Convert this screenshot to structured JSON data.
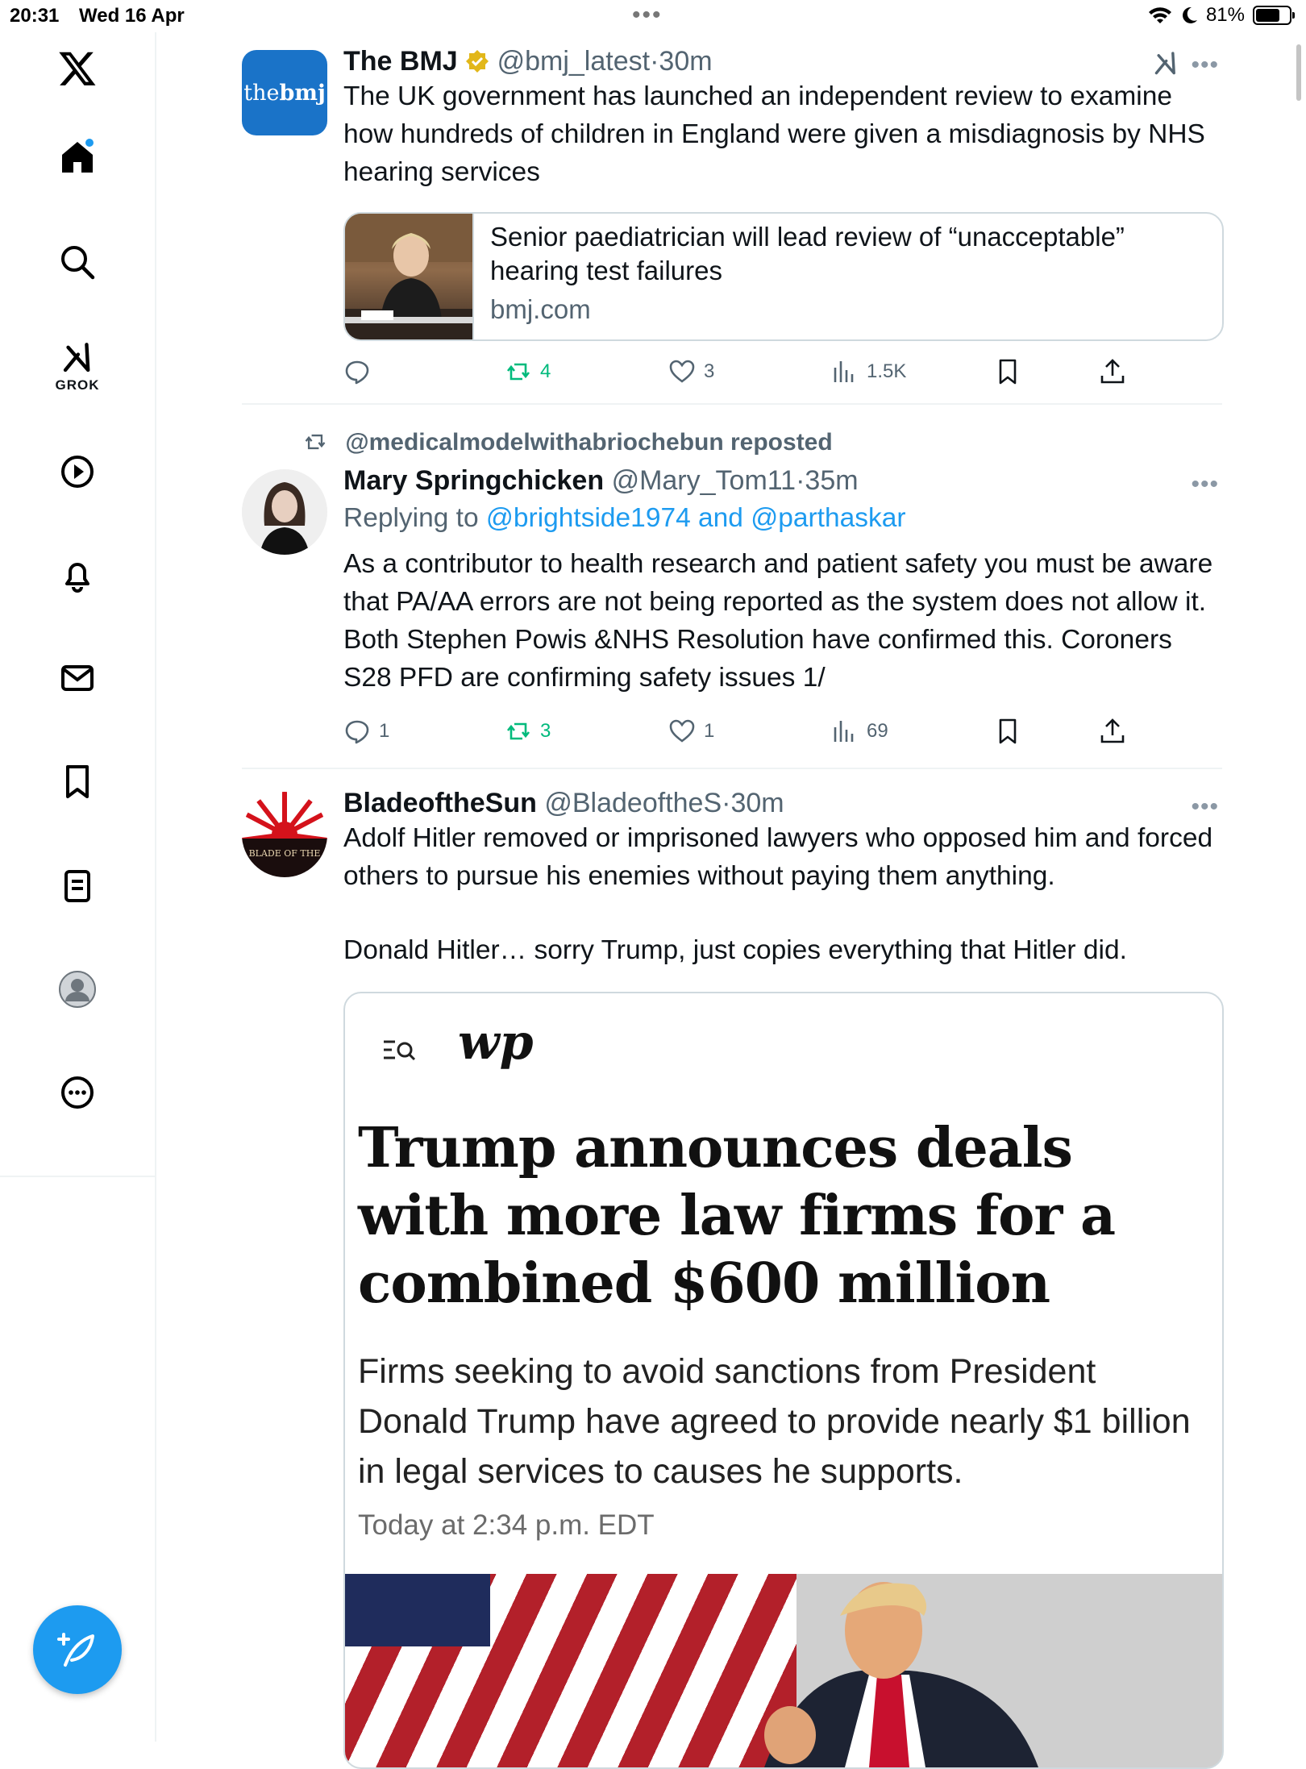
{
  "status_bar": {
    "time": "20:31",
    "date": "Wed 16 Apr",
    "battery": "81%",
    "battery_level": 0.81
  },
  "sidebar": {
    "grok_label": "GROK",
    "items": [
      "home",
      "search",
      "grok",
      "video",
      "notifications",
      "messages",
      "bookmarks",
      "lists",
      "profile",
      "more"
    ]
  },
  "tweets": [
    {
      "name": "The BMJ",
      "handle": "@bmj_latest",
      "time": "30m",
      "avatar_text_light": "the",
      "avatar_text_bold": "bmj",
      "text": "The UK government has launched an independent review to examine how hundreds of children in England were given a misdiagnosis by NHS hearing services",
      "card": {
        "title": "Senior paediatrician will lead review of “unacceptable” hearing test failures",
        "domain": "bmj.com"
      },
      "actions": {
        "reply": "",
        "repost": "4",
        "like": "3",
        "views": "1.5K"
      }
    },
    {
      "repost_label": "@medicalmodelwithabriochebun reposted",
      "name": "Mary Springchicken",
      "handle": "@Mary_Tom11",
      "time": "35m",
      "replying_prefix": "Replying to",
      "replying_to": "@brightside1974 and @parthaskar",
      "text": "As a contributor to health research and patient safety you must be aware that PA/AA errors are not being reported as the system does not allow it. Both Stephen Powis &NHS Resolution have confirmed this. Coroners S28 PFD are confirming safety issues 1/",
      "actions": {
        "reply": "1",
        "repost": "3",
        "like": "1",
        "views": "69"
      }
    },
    {
      "name": "BladeoftheSun",
      "handle": "@BladeoftheS",
      "time": "30m",
      "avatar_text": "BLADE OF THE",
      "text_p1": "Adolf Hitler removed or imprisoned lawyers who opposed him and forced others to pursue his enemies without paying them anything.",
      "text_p2": "Donald Hitler… sorry Trump, just copies everything that Hitler did.",
      "media": {
        "logo": "wp",
        "headline": "Trump announces deals with more law firms for a combined $600 million",
        "dek": "Firms seeking to avoid sanctions from President Donald Trump have agreed to provide nearly $1 billion in legal services to causes he supports.",
        "timestamp": "Today at 2:34 p.m. EDT"
      }
    }
  ]
}
